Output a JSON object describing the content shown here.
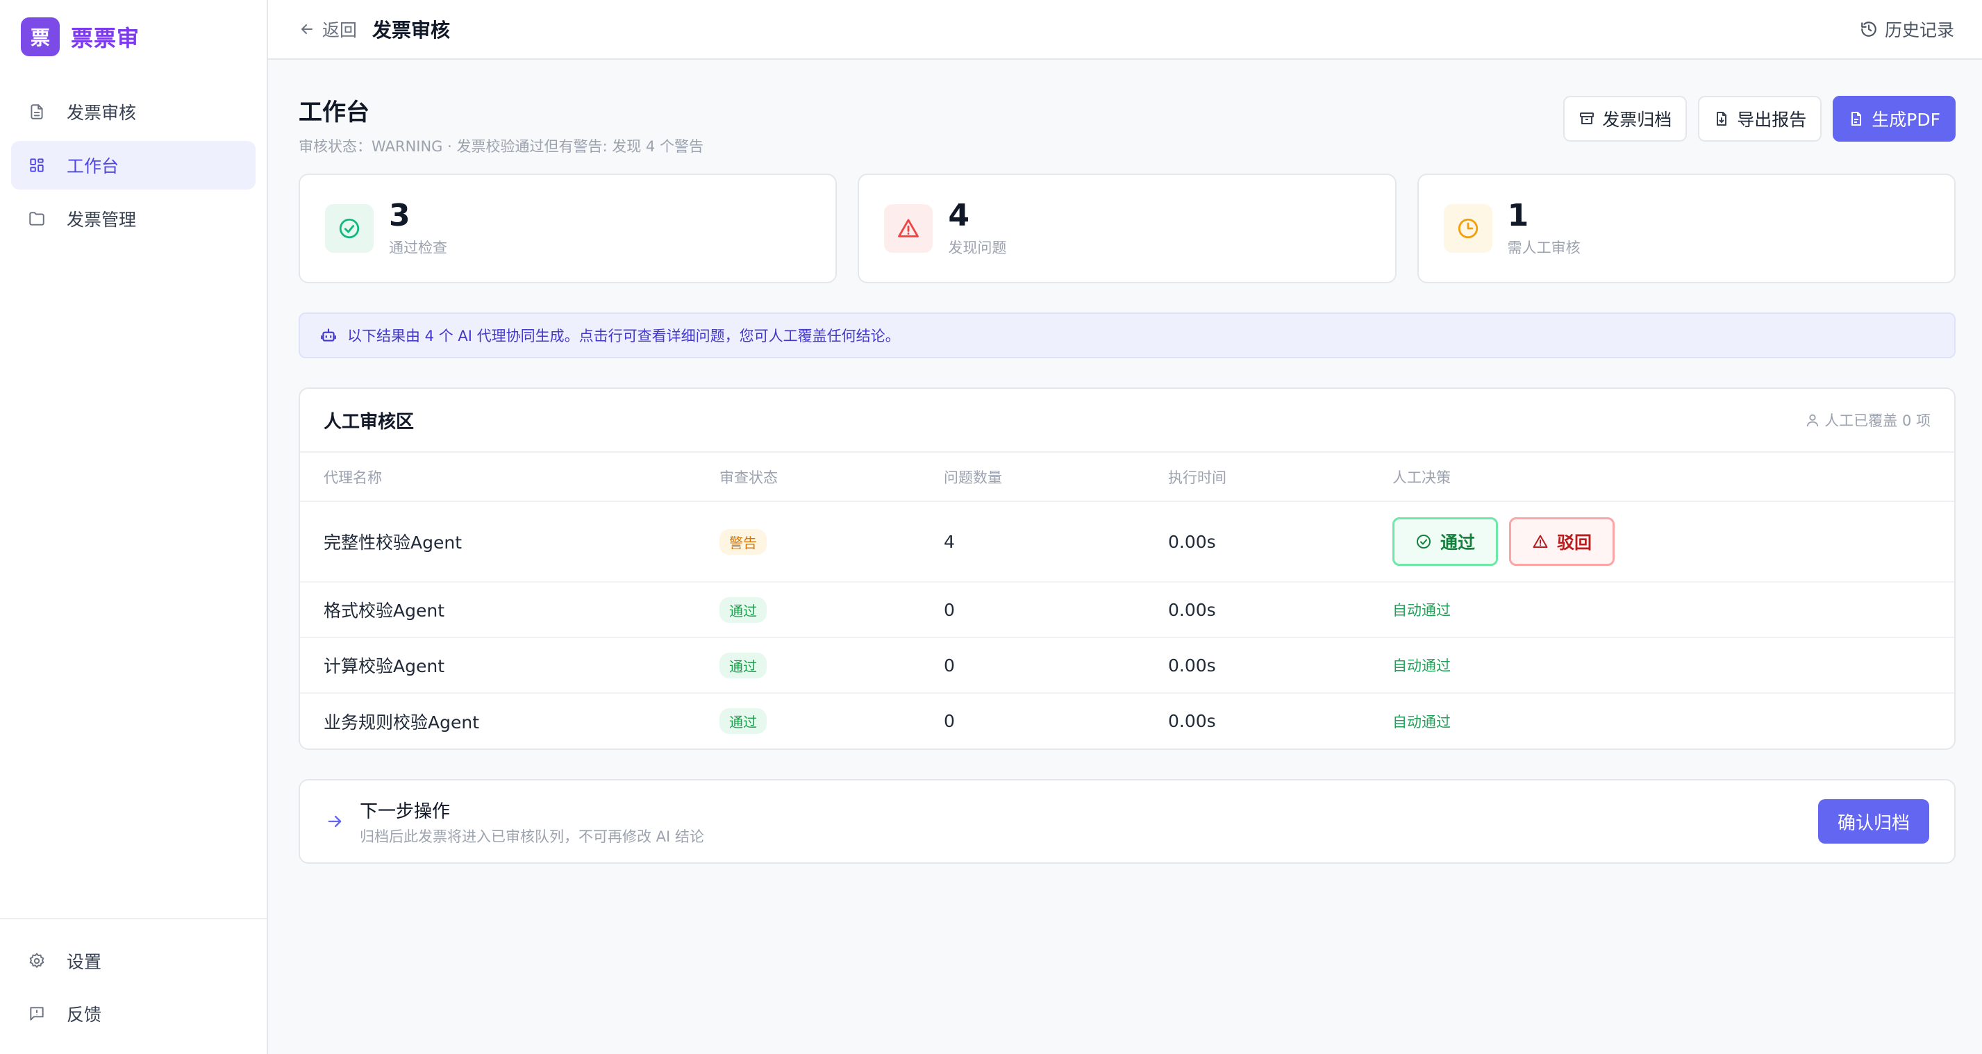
{
  "brand": {
    "logo_text": "票",
    "name": "票票审"
  },
  "sidebar": {
    "items": [
      {
        "label": "发票审核",
        "icon": "document-icon"
      },
      {
        "label": "工作台",
        "icon": "grid-icon",
        "active": true
      },
      {
        "label": "发票管理",
        "icon": "folder-icon"
      }
    ],
    "bottom": [
      {
        "label": "设置",
        "icon": "gear-icon"
      },
      {
        "label": "反馈",
        "icon": "feedback-icon"
      }
    ]
  },
  "topbar": {
    "back_label": "返回",
    "title": "发票审核",
    "history_label": "历史记录"
  },
  "page": {
    "title": "工作台",
    "subtitle": "审核状态：WARNING · 发票校验通过但有警告: 发现 4 个警告"
  },
  "actions": {
    "archive": "发票归档",
    "export": "导出报告",
    "pdf": "生成PDF"
  },
  "stats": [
    {
      "value": "3",
      "label": "通过检查",
      "color": "#10b981"
    },
    {
      "value": "4",
      "label": "发现问题",
      "color": "#ef4444"
    },
    {
      "value": "1",
      "label": "需人工审核",
      "color": "#f59e0b"
    }
  ],
  "notice": "以下结果由 4 个 AI 代理协同生成。点击行可查看详细问题，您可人工覆盖任何结论。",
  "review": {
    "title": "人工审核区",
    "override_count": "人工已覆盖 0 项",
    "columns": [
      "代理名称",
      "审查状态",
      "问题数量",
      "执行时间",
      "人工决策"
    ],
    "rows": [
      {
        "name": "完整性校验Agent",
        "status": "警告",
        "issues": "4",
        "time": "0.00s",
        "decision": ""
      },
      {
        "name": "格式校验Agent",
        "status": "通过",
        "issues": "0",
        "time": "0.00s",
        "decision": "自动通过"
      },
      {
        "name": "计算校验Agent",
        "status": "通过",
        "issues": "0",
        "time": "0.00s",
        "decision": "自动通过"
      },
      {
        "name": "业务规则校验Agent",
        "status": "通过",
        "issues": "0",
        "time": "0.00s",
        "decision": "自动通过"
      }
    ],
    "approve_label": "通过",
    "reject_label": "驳回"
  },
  "next": {
    "title": "下一步操作",
    "subtitle": "归档后此发票将进入已审核队列，不可再修改 AI 结论",
    "confirm_label": "确认归档"
  },
  "colors": {
    "accent": "#6366f1",
    "brand": "#7c3aed",
    "success": "#16a34a",
    "danger": "#ef4444",
    "warning": "#f59e0b"
  }
}
